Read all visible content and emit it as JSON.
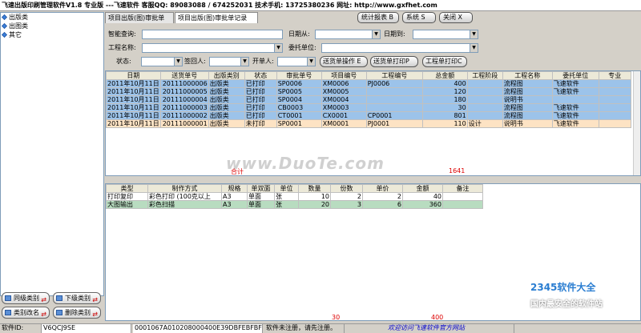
{
  "window": {
    "title": "飞速出版印刷管理软件V1.8  专业版  ---飞速软件  客服QQ: 89083088 / 674252031  技术手机: 13725380236  网址: http://www.gxfhet.com"
  },
  "sidebar": {
    "items": [
      {
        "label": "出版类"
      },
      {
        "label": "出图类"
      },
      {
        "label": "其它"
      }
    ],
    "buttons": {
      "same_level": "同级类别",
      "sub_level": "下级类别",
      "rename": "类别改名",
      "delete": "删除类别"
    }
  },
  "tabs": [
    {
      "label": "项目出版(图)审批单"
    },
    {
      "label": "项目出版(图)审批单记录"
    }
  ],
  "toolbar": {
    "stats": "统计报表 B",
    "system": "系统 S",
    "close": "关闭 X"
  },
  "form": {
    "smart_query": "智能查询:",
    "date_from": "日期从:",
    "date_to": "日期到:",
    "project_name": "工程名称:",
    "client": "委托单位:",
    "status": "状态:",
    "signer": "签回人:",
    "opener": "开单人:",
    "btn_delivery_op": "送货单操作 E",
    "btn_delivery_print": "送货单打印P",
    "btn_project_print": "工程单打印C"
  },
  "main_table": {
    "headers": [
      "日期",
      "送货单号",
      "出版类别",
      "状态",
      "审批单号",
      "项目编号",
      "工程编号",
      "总金额",
      "工程阶段",
      "工程名称",
      "委托单位",
      "专业"
    ],
    "rows": [
      [
        "2011年10月11日",
        "20111000006",
        "出版类",
        "已打印",
        "SP0006",
        "XM0006",
        "PJ0006",
        "400",
        "",
        "流程图",
        "飞速软件",
        ""
      ],
      [
        "2011年10月11日",
        "20111000005",
        "出版类",
        "已打印",
        "SP0005",
        "XM0005",
        "",
        "120",
        "",
        "流程图",
        "飞速软件",
        ""
      ],
      [
        "2011年10月11日",
        "20111000004",
        "出版类",
        "已打印",
        "SP0004",
        "XM0004",
        "",
        "180",
        "",
        "说明书",
        "",
        ""
      ],
      [
        "2011年10月11日",
        "20111000003",
        "出版类",
        "已打印",
        "CB0003",
        "XM0003",
        "",
        "30",
        "",
        "流程图",
        "飞速软件",
        ""
      ],
      [
        "2011年10月11日",
        "20111000002",
        "出版类",
        "已打印",
        "CT0001",
        "CX0001",
        "CP0001",
        "801",
        "",
        "流程图",
        "飞速软件",
        ""
      ],
      [
        "2011年10月11日",
        "20111000001",
        "出版类",
        "未打印",
        "SP0001",
        "XM0001",
        "PJ0001",
        "110",
        "设计",
        "说明书",
        "飞速软件",
        ""
      ]
    ],
    "footer_label": "合计",
    "footer_total": "1641"
  },
  "detail_table": {
    "headers": [
      "类型",
      "制作方式",
      "规格",
      "单双面",
      "单位",
      "数量",
      "份数",
      "单价",
      "金额",
      "备注"
    ],
    "rows": [
      [
        "打印复印",
        "彩色打印 (100克以上",
        "A3",
        "单面",
        "张",
        "10",
        "2",
        "2",
        "40",
        ""
      ],
      [
        "大图输出",
        "彩色扫描",
        "A3",
        "单面",
        "张",
        "20",
        "3",
        "6",
        "360",
        ""
      ]
    ],
    "footer_qty": "30",
    "footer_amount": "400"
  },
  "status": {
    "software_id_label": "软件ID:",
    "software_id": "V6QCJ9SE",
    "reg_code": "0001067A010208000400E39DBFEBFBFF",
    "unregistered": "软件未注册，请先注册。",
    "welcome": "欢迎访问飞速软件官方网站"
  },
  "watermark": {
    "text": "www.DuoTe.com",
    "site": "2345软件大全",
    "slogan": "国内最安全的软件站"
  }
}
